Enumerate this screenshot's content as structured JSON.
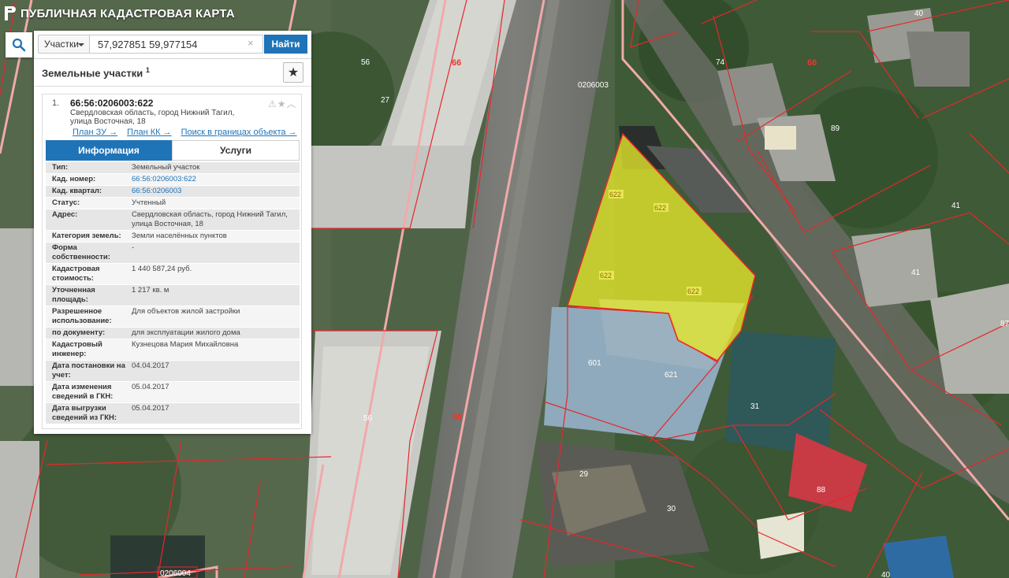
{
  "app": {
    "title": "ПУБЛИЧНАЯ КАДАСТРОВАЯ КАРТА"
  },
  "search": {
    "type_label": "Участки",
    "query": "57,927851 59,977154",
    "find_label": "Найти"
  },
  "results": {
    "title": "Земельные участки",
    "count": "1",
    "item": {
      "index": "1.",
      "cad_number": "66:56:0206003:622",
      "address": "Свердловская область, город Нижний Тагил, улица Восточная, 18",
      "links": [
        "План ЗУ →",
        "План КК →",
        "Поиск в границах объекта →"
      ],
      "tabs": {
        "info": "Информация",
        "services": "Услуги"
      },
      "properties": [
        {
          "key": "Тип:",
          "value": "Земельный участок"
        },
        {
          "key": "Кад. номер:",
          "value": "66:56:0206003:622"
        },
        {
          "key": "Кад. квартал:",
          "value": "66:56:0206003"
        },
        {
          "key": "Статус:",
          "value": "Учтенный"
        },
        {
          "key": "Адрес:",
          "value": "Свердловская область, город Нижний Тагил, улица Восточная, 18"
        },
        {
          "key": "Категория земель:",
          "value": "Земли населённых пунктов"
        },
        {
          "key": "Форма собственности:",
          "value": "-"
        },
        {
          "key": "Кадастровая стоимость:",
          "value": "1 440 587,24 руб."
        },
        {
          "key": "Уточненная площадь:",
          "value": "1 217 кв. м"
        },
        {
          "key": "Разрешенное использование:",
          "value": "Для объектов жилой застройки"
        },
        {
          "key": "по документу:",
          "value": "для эксплуатации жилого дома"
        },
        {
          "key": "Кадастровый инженер:",
          "value": "Кузнецова Мария Михайловна"
        },
        {
          "key": "Дата постановки на учет:",
          "value": "04.04.2017"
        },
        {
          "key": "Дата изменения сведений в ГКН:",
          "value": "05.04.2017"
        },
        {
          "key": "Дата выгрузки сведений из ГКН:",
          "value": "05.04.2017"
        }
      ]
    }
  },
  "map": {
    "quarter_labels": {
      "main": "0206003",
      "bottom": "0206004"
    },
    "parcel_labels": [
      "56",
      "66",
      "27",
      "74",
      "66",
      "40",
      "89",
      "41",
      "41",
      "87",
      "601",
      "621",
      "31",
      "88",
      "29",
      "30",
      "66",
      "56",
      "40"
    ],
    "selected_parcel_labels": [
      "622",
      "622",
      "622",
      "622"
    ]
  },
  "colors": {
    "accent": "#1f73b7",
    "parcel_border": "#e8262b",
    "selected_fill": "#e8e62a"
  }
}
